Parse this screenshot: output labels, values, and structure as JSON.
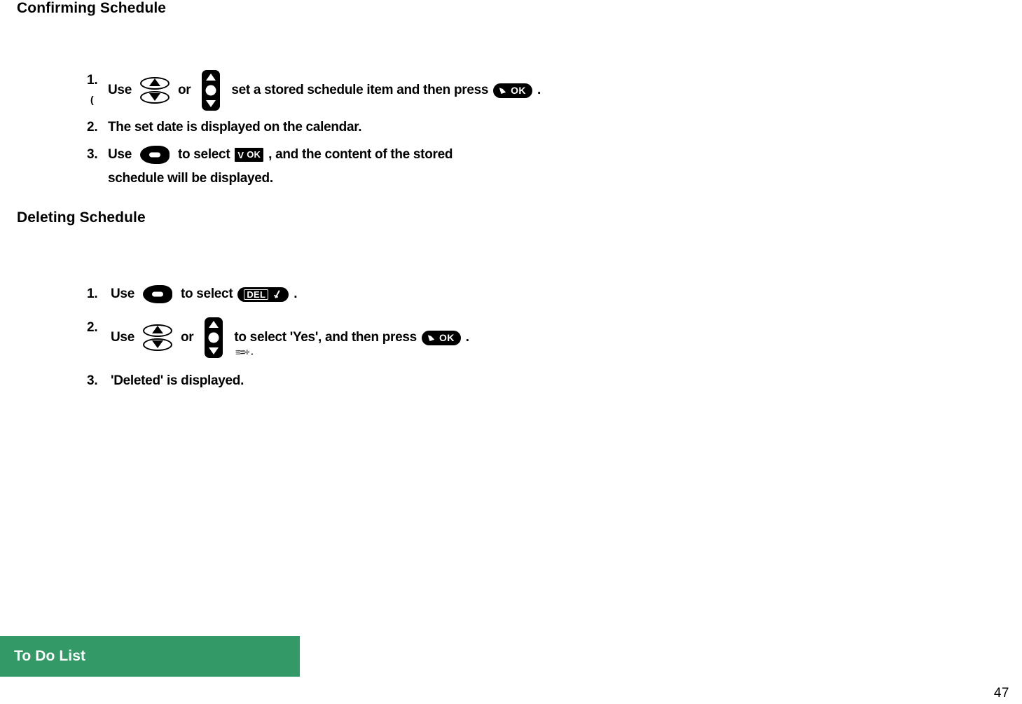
{
  "document": {
    "page_number": "47"
  },
  "sections": [
    {
      "heading": "Confirming Schedule",
      "steps": [
        {
          "number": "1.",
          "text_before": "Use",
          "icon_1": "updown-ellipse-key-icon",
          "text_middle": "or",
          "icon_2": "vertical-rocker-key-icon",
          "text_after": "set a stored schedule item and then press",
          "badge": {
            "type": "pill",
            "glyph": "cursor-arrow-icon",
            "label": "OK"
          },
          "text_end": "."
        },
        {
          "number": "2.",
          "text": "The set date is displayed on the calendar."
        },
        {
          "number": "3.",
          "text_before": "Use",
          "icon_1": "softkey-blob-icon",
          "text_middle": "to select",
          "badge": {
            "type": "rect",
            "glyph": "V",
            "label": "OK"
          },
          "text_after": ", and the content of the stored",
          "text_wrapped": "schedule will be displayed."
        }
      ]
    },
    {
      "heading": "Deleting Schedule",
      "steps": [
        {
          "number": "1.",
          "text_before": "Use",
          "icon_1": "softkey-blob-icon",
          "text_middle": "to select",
          "badge": {
            "type": "pill",
            "label": "DEL",
            "glyph": "delete-slash-icon"
          },
          "text_end": "."
        },
        {
          "number": "2.",
          "text_before": "Use",
          "icon_1": "updown-ellipse-key-icon",
          "text_middle": "or",
          "icon_2": "vertical-rocker-key-icon",
          "text_after": "to select 'Yes', and then press",
          "badge": {
            "type": "pill",
            "glyph": "cursor-arrow-icon",
            "label": "OK"
          },
          "text_end": "."
        },
        {
          "number": "3.",
          "text": "'Deleted' is displayed."
        }
      ]
    }
  ],
  "banner": {
    "label": "To Do List",
    "color": "#339966"
  },
  "artifacts": {
    "tick_mark": "(",
    "smudge": "≡=÷ ."
  }
}
